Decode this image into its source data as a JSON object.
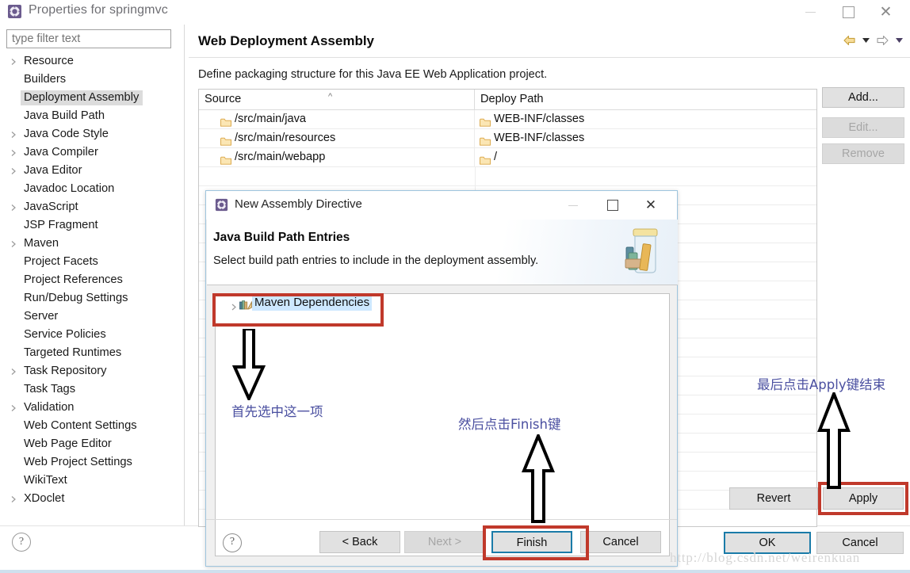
{
  "window": {
    "title": "Properties for springmvc",
    "icon": "eclipse-properties-icon",
    "minimize": "minimize-icon",
    "maximize": "maximize-icon",
    "close": "close-icon"
  },
  "sidebar": {
    "filter": {
      "placeholder": "type filter text",
      "value": ""
    },
    "items": [
      {
        "label": "Resource",
        "expandable": true,
        "selected": false
      },
      {
        "label": "Builders",
        "expandable": false,
        "selected": false
      },
      {
        "label": "Deployment Assembly",
        "expandable": false,
        "selected": true
      },
      {
        "label": "Java Build Path",
        "expandable": false,
        "selected": false
      },
      {
        "label": "Java Code Style",
        "expandable": true,
        "selected": false
      },
      {
        "label": "Java Compiler",
        "expandable": true,
        "selected": false
      },
      {
        "label": "Java Editor",
        "expandable": true,
        "selected": false
      },
      {
        "label": "Javadoc Location",
        "expandable": false,
        "selected": false
      },
      {
        "label": "JavaScript",
        "expandable": true,
        "selected": false
      },
      {
        "label": "JSP Fragment",
        "expandable": false,
        "selected": false
      },
      {
        "label": "Maven",
        "expandable": true,
        "selected": false
      },
      {
        "label": "Project Facets",
        "expandable": false,
        "selected": false
      },
      {
        "label": "Project References",
        "expandable": false,
        "selected": false
      },
      {
        "label": "Run/Debug Settings",
        "expandable": false,
        "selected": false
      },
      {
        "label": "Server",
        "expandable": false,
        "selected": false
      },
      {
        "label": "Service Policies",
        "expandable": false,
        "selected": false
      },
      {
        "label": "Targeted Runtimes",
        "expandable": false,
        "selected": false
      },
      {
        "label": "Task Repository",
        "expandable": true,
        "selected": false
      },
      {
        "label": "Task Tags",
        "expandable": false,
        "selected": false
      },
      {
        "label": "Validation",
        "expandable": true,
        "selected": false
      },
      {
        "label": "Web Content Settings",
        "expandable": false,
        "selected": false
      },
      {
        "label": "Web Page Editor",
        "expandable": false,
        "selected": false
      },
      {
        "label": "Web Project Settings",
        "expandable": false,
        "selected": false
      },
      {
        "label": "WikiText",
        "expandable": false,
        "selected": false
      },
      {
        "label": "XDoclet",
        "expandable": true,
        "selected": false
      }
    ],
    "help_icon": "help-icon"
  },
  "page": {
    "title": "Web Deployment Assembly",
    "description": "Define packaging structure for this Java EE Web Application project.",
    "nav": {
      "back_icon": "back-arrow-icon",
      "back_menu_icon": "chevron-down-icon",
      "forward_icon": "forward-arrow-icon",
      "forward_menu_icon": "chevron-down-icon"
    },
    "table": {
      "columns": [
        "Source",
        "Deploy Path"
      ],
      "sort_indicator": "sort-asc-icon",
      "rows": [
        {
          "source": "/src/main/java",
          "deploy": "WEB-INF/classes"
        },
        {
          "source": "/src/main/resources",
          "deploy": "WEB-INF/classes"
        },
        {
          "source": "/src/main/webapp",
          "deploy": "/"
        }
      ]
    },
    "side_buttons": [
      {
        "label": "Add...",
        "disabled": false
      },
      {
        "label": "Edit...",
        "disabled": true
      },
      {
        "label": "Remove",
        "disabled": true
      }
    ],
    "footer_buttons": {
      "revert": "Revert",
      "apply": "Apply",
      "ok": "OK",
      "cancel": "Cancel"
    }
  },
  "dialog": {
    "title": "New Assembly Directive",
    "icon": "eclipse-wizard-icon",
    "minimize": "minimize-icon",
    "maximize": "maximize-icon",
    "close": "close-icon",
    "banner_title": "Java Build Path Entries",
    "banner_subtitle": "Select build path entries to include in the deployment assembly.",
    "banner_icon": "jar-with-books-icon",
    "list": [
      {
        "label": "Maven Dependencies",
        "icon": "library-books-icon",
        "selected": true,
        "expandable": true
      }
    ],
    "help_icon": "help-icon",
    "buttons": {
      "back": "< Back",
      "next": "Next >",
      "finish": "Finish",
      "cancel": "Cancel"
    }
  },
  "annotations": {
    "note_select_item": "首先选中这一项",
    "note_click_finish": "然后点击Finish键",
    "note_click_apply": "最后点击Apply键结束",
    "highlight_color": "#c0392b",
    "note_color": "#4a4fa0"
  },
  "watermark": "http://blog.csdn.net/weirenkuan"
}
